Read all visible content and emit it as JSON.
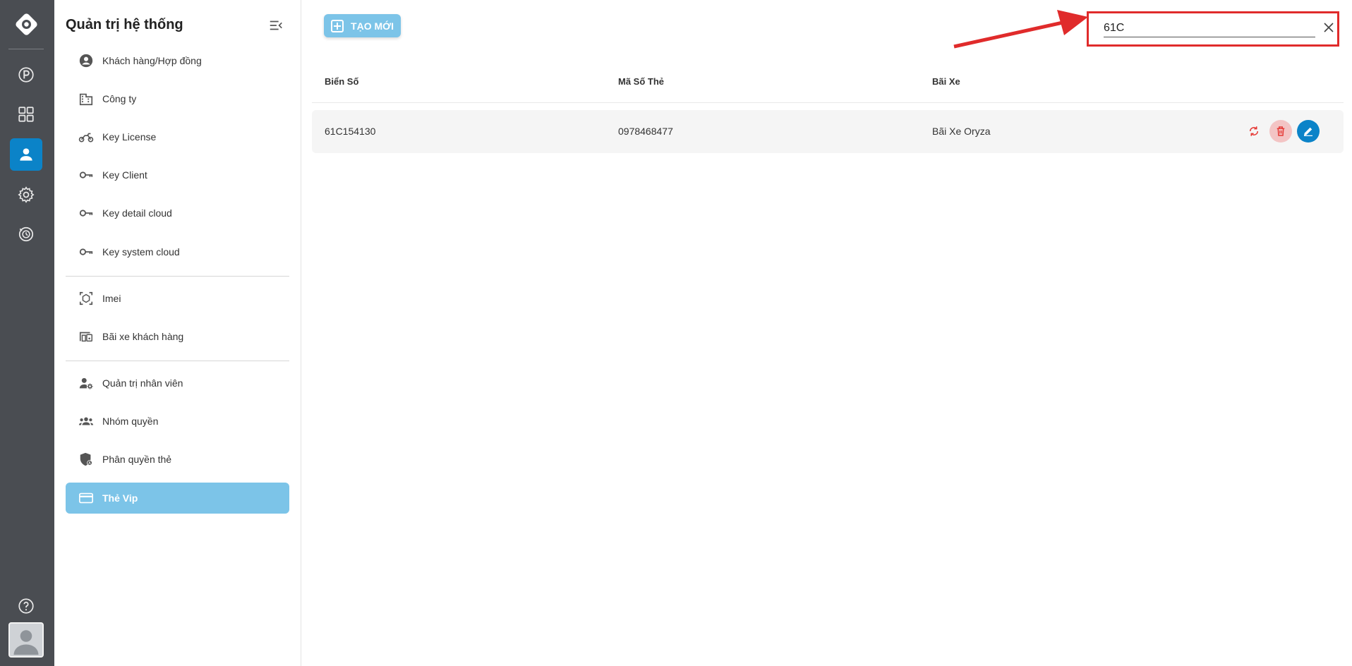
{
  "sidebar": {
    "title": "Quản trị hệ thống",
    "groups": [
      [
        {
          "label": "Khách hàng/Hợp đồng",
          "icon": "account-circle-icon"
        },
        {
          "label": "Công ty",
          "icon": "building-icon"
        },
        {
          "label": "Key License",
          "icon": "motorcycle-icon"
        },
        {
          "label": "Key Client",
          "icon": "key-icon"
        },
        {
          "label": "Key detail cloud",
          "icon": "key-icon"
        },
        {
          "label": "Key system cloud",
          "icon": "key-icon"
        }
      ],
      [
        {
          "label": "Imei",
          "icon": "scan-cube-icon"
        },
        {
          "label": "Bãi xe khách hàng",
          "icon": "devices-icon"
        }
      ],
      [
        {
          "label": "Quản trị nhân viên",
          "icon": "user-cog-icon"
        },
        {
          "label": "Nhóm quyền",
          "icon": "group-icon"
        },
        {
          "label": "Phân quyền thẻ",
          "icon": "shield-icon"
        },
        {
          "label": "Thẻ Vip",
          "icon": "credit-card-icon",
          "active": true
        }
      ]
    ]
  },
  "toolbar": {
    "create_label": "TẠO MỚI"
  },
  "search": {
    "value": "61C"
  },
  "table": {
    "headers": [
      "Biển Số",
      "Mã Số Thẻ",
      "Bãi Xe"
    ],
    "rows": [
      [
        "61C154130",
        "0978468477",
        "Bãi Xe Oryza"
      ]
    ]
  },
  "colors": {
    "rail_bg": "#4a4d52",
    "accent": "#0b83c8",
    "accent_light": "#7cc4e8",
    "highlight_red": "#e02b2b",
    "delete_red": "#e53935"
  }
}
